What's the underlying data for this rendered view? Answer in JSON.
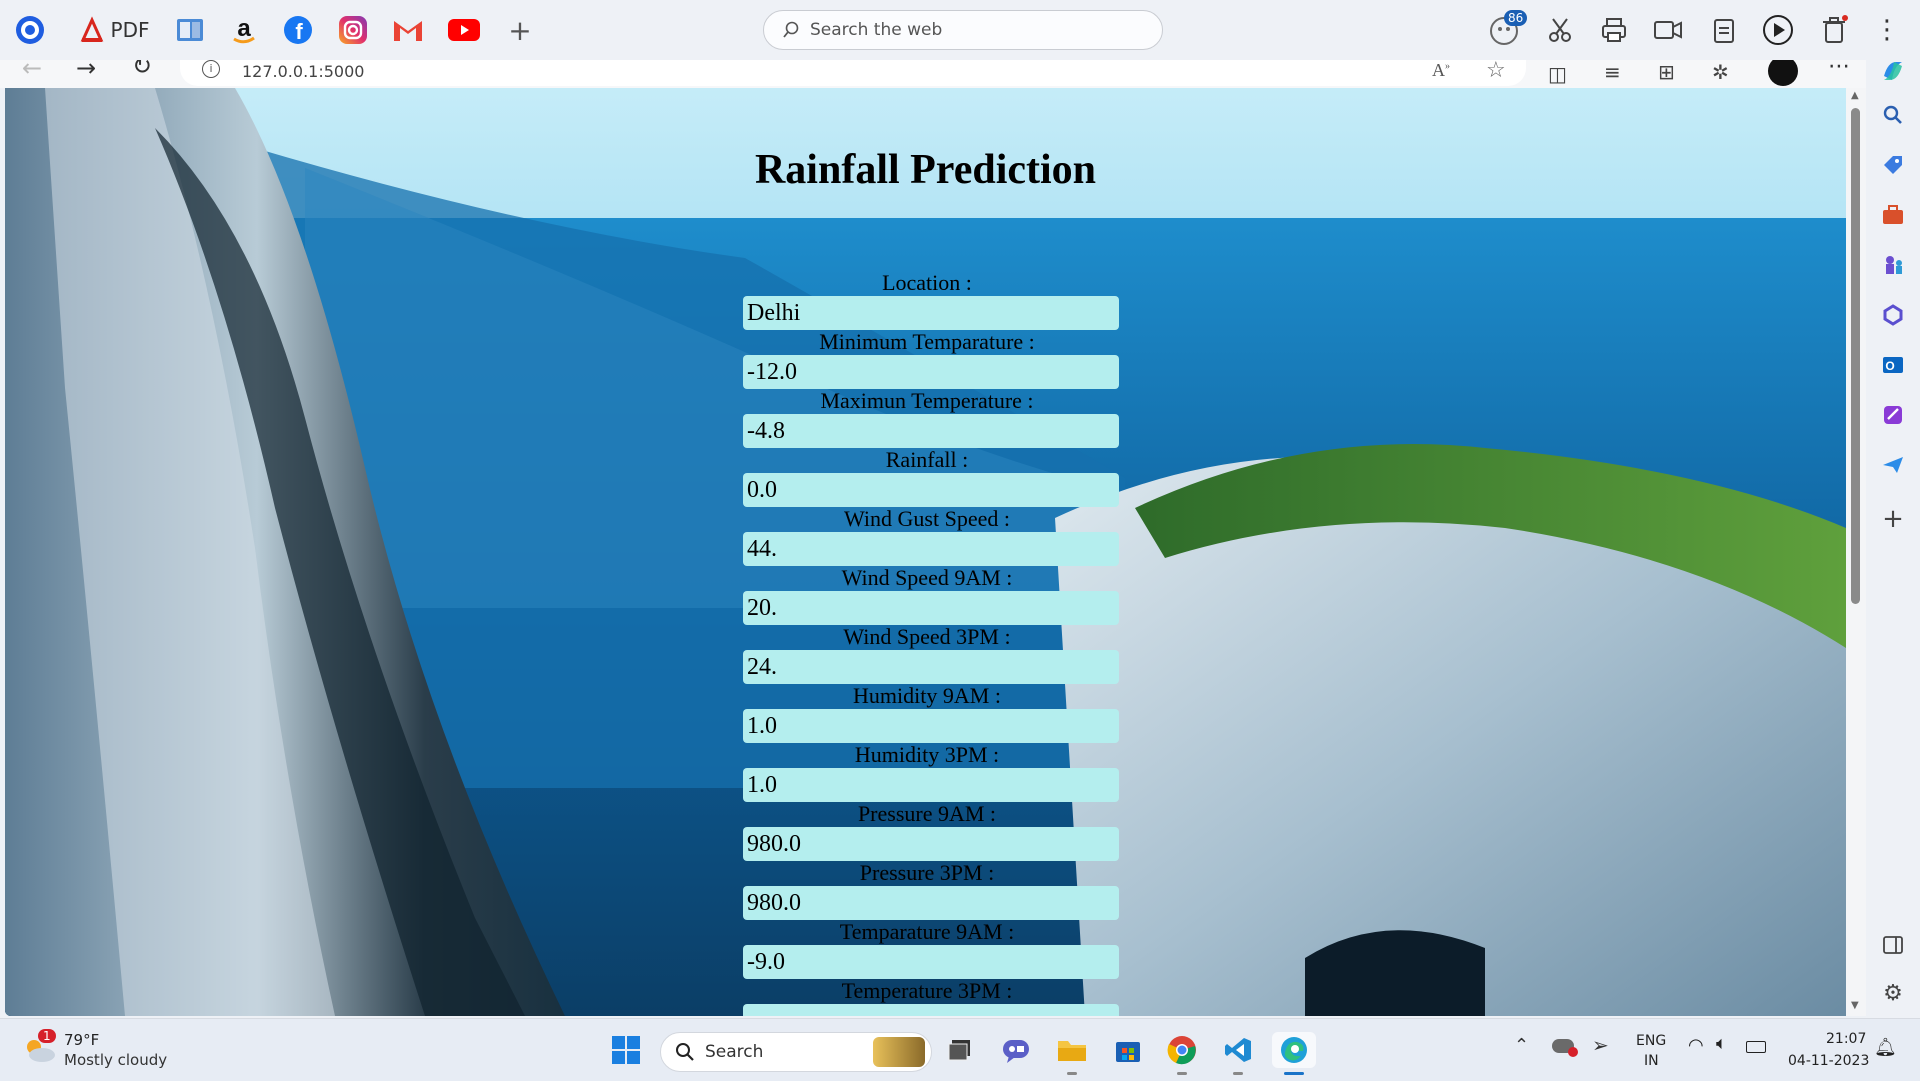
{
  "toolbar": {
    "pdf_label": "PDF",
    "search_placeholder": "Search the web",
    "notification_count": "86"
  },
  "address_bar": {
    "url": "127.0.0.1:5000"
  },
  "page": {
    "title": "Rainfall Prediction",
    "fields": [
      {
        "label": "Location :",
        "value": "Delhi"
      },
      {
        "label": "Minimum Temparature :",
        "value": "-12.0"
      },
      {
        "label": "Maximun Temperature :",
        "value": "-4.8"
      },
      {
        "label": "Rainfall :",
        "value": "0.0"
      },
      {
        "label": "Wind Gust Speed :",
        "value": "44."
      },
      {
        "label": "Wind Speed 9AM :",
        "value": "20."
      },
      {
        "label": "Wind Speed 3PM :",
        "value": "24."
      },
      {
        "label": "Humidity 9AM :",
        "value": "1.0"
      },
      {
        "label": "Humidity 3PM :",
        "value": "1.0"
      },
      {
        "label": "Pressure 9AM :",
        "value": "980.0"
      },
      {
        "label": "Pressure 3PM :",
        "value": "980.0"
      },
      {
        "label": "Temparature 9AM :",
        "value": "-9.0"
      },
      {
        "label": "Temperature 3PM :",
        "value": ""
      }
    ]
  },
  "taskbar": {
    "weather_temp": "79°F",
    "weather_desc": "Mostly cloudy",
    "weather_badge": "1",
    "search_label": "Search",
    "lang_top": "ENG",
    "lang_bottom": "IN",
    "time": "21:07",
    "date": "04-11-2023"
  },
  "colors": {
    "field_bg": "#b4eeee",
    "chrome_bg": "#eef1f6",
    "taskbar_bg": "#e7ecf4"
  }
}
